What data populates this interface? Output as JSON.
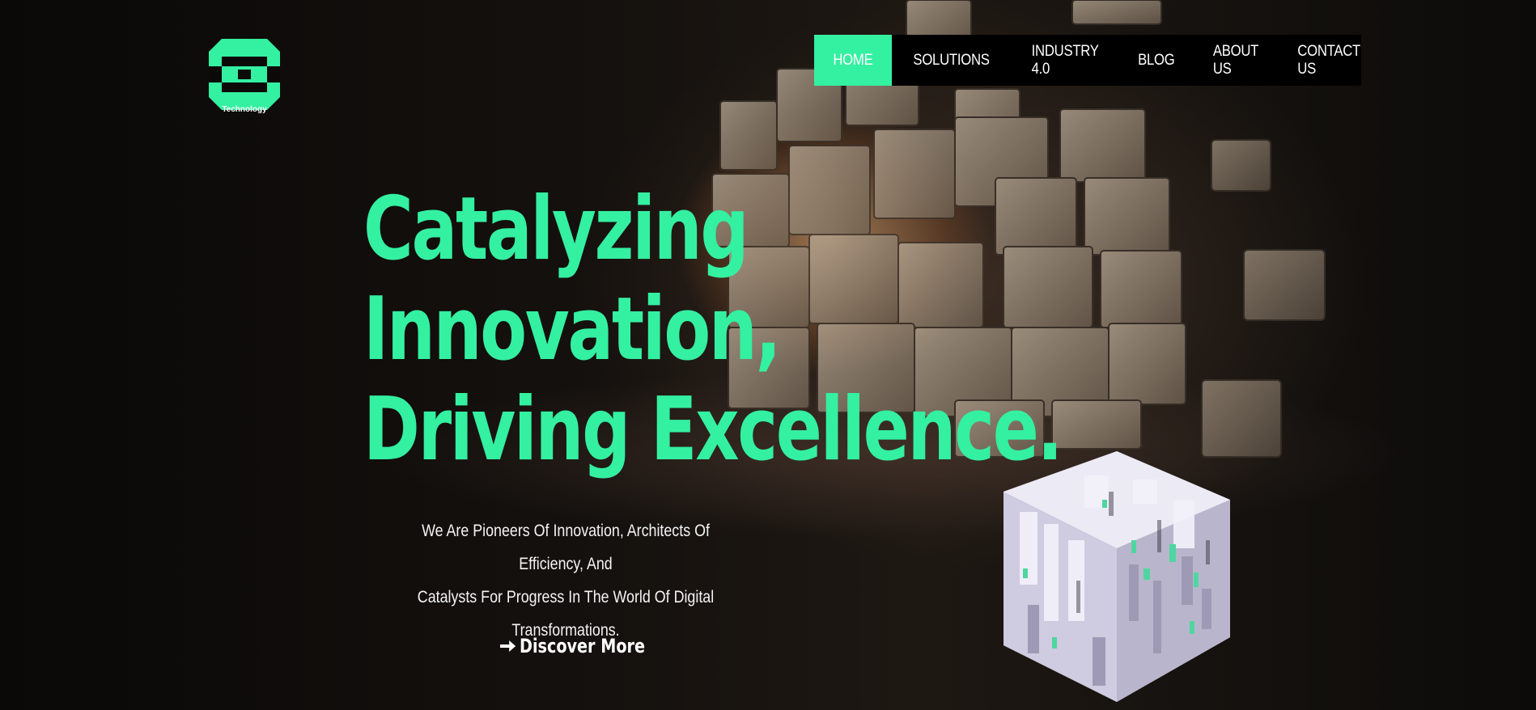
{
  "brand": {
    "logo_icon": "octagon-logo-icon",
    "caption": "Technology",
    "accent_color": "#34f0a1"
  },
  "nav": {
    "items": [
      {
        "label": "HOME",
        "active": true
      },
      {
        "label": "SOLUTIONS",
        "active": false
      },
      {
        "label": "INDUSTRY 4.0",
        "active": false
      },
      {
        "label": "BLOG",
        "active": false
      },
      {
        "label": "ABOUT US",
        "active": false
      },
      {
        "label": "CONTACT US",
        "active": false
      }
    ]
  },
  "hero": {
    "headline_lines": [
      "Catalyzing",
      "Innovation,",
      "Driving Excellence."
    ],
    "subtext_lines": [
      "We Are Pioneers Of Innovation, Architects Of Efficiency, And",
      "Catalysts For Progress In The World Of Digital Transformations."
    ],
    "cta_label": "Discover More",
    "cta_icon": "arrow-right-icon"
  }
}
